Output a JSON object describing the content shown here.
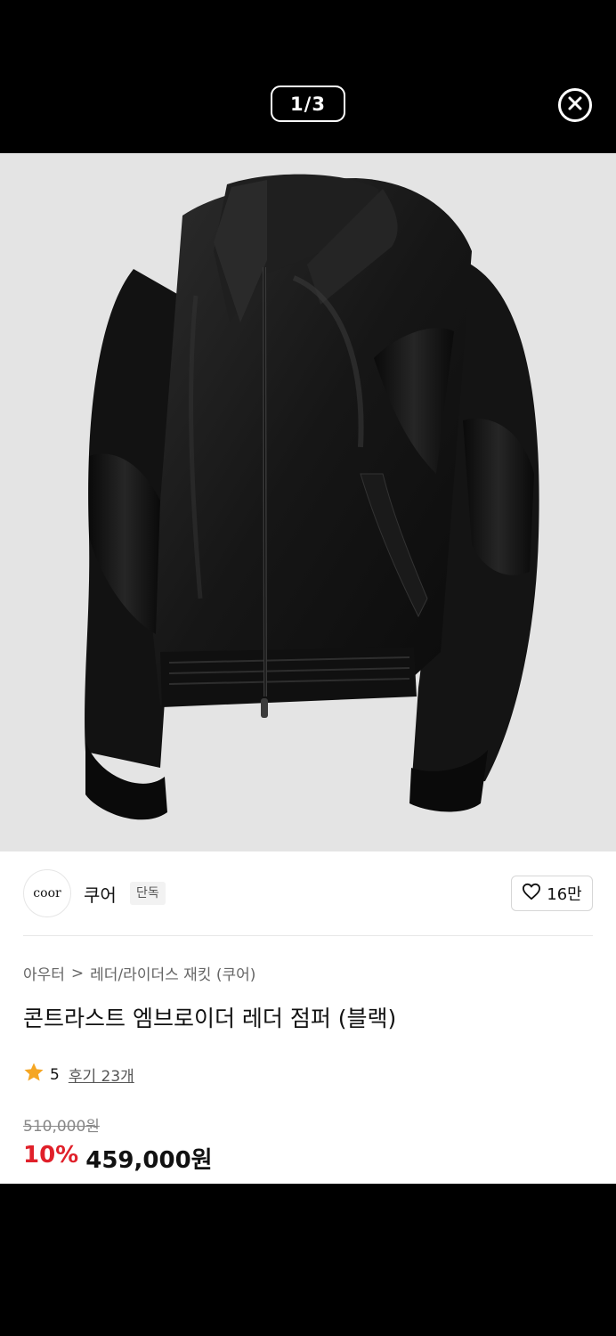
{
  "viewer": {
    "pager": "1/3",
    "close_icon": "close-circle-icon"
  },
  "product_image": {
    "subject": "black leather bomber jacket",
    "background": "#e4e4e4"
  },
  "brand": {
    "logo_text": "coor",
    "name": "쿠어",
    "badge": "단독"
  },
  "like": {
    "icon": "heart-outline-icon",
    "count": "16만"
  },
  "breadcrumb": {
    "category": "아우터",
    "separator": ">",
    "subcategory": "레더/라이더스 재킷 (쿠어)"
  },
  "product": {
    "title": "콘트라스트 엠브로이더 레더 점퍼 (블랙)"
  },
  "rating": {
    "star_icon": "star-icon",
    "score": "5",
    "reviews": "후기 23개"
  },
  "price": {
    "original": "510,000원",
    "discount": "10%",
    "sale": "459,000원",
    "discount_color": "#e0202a"
  }
}
